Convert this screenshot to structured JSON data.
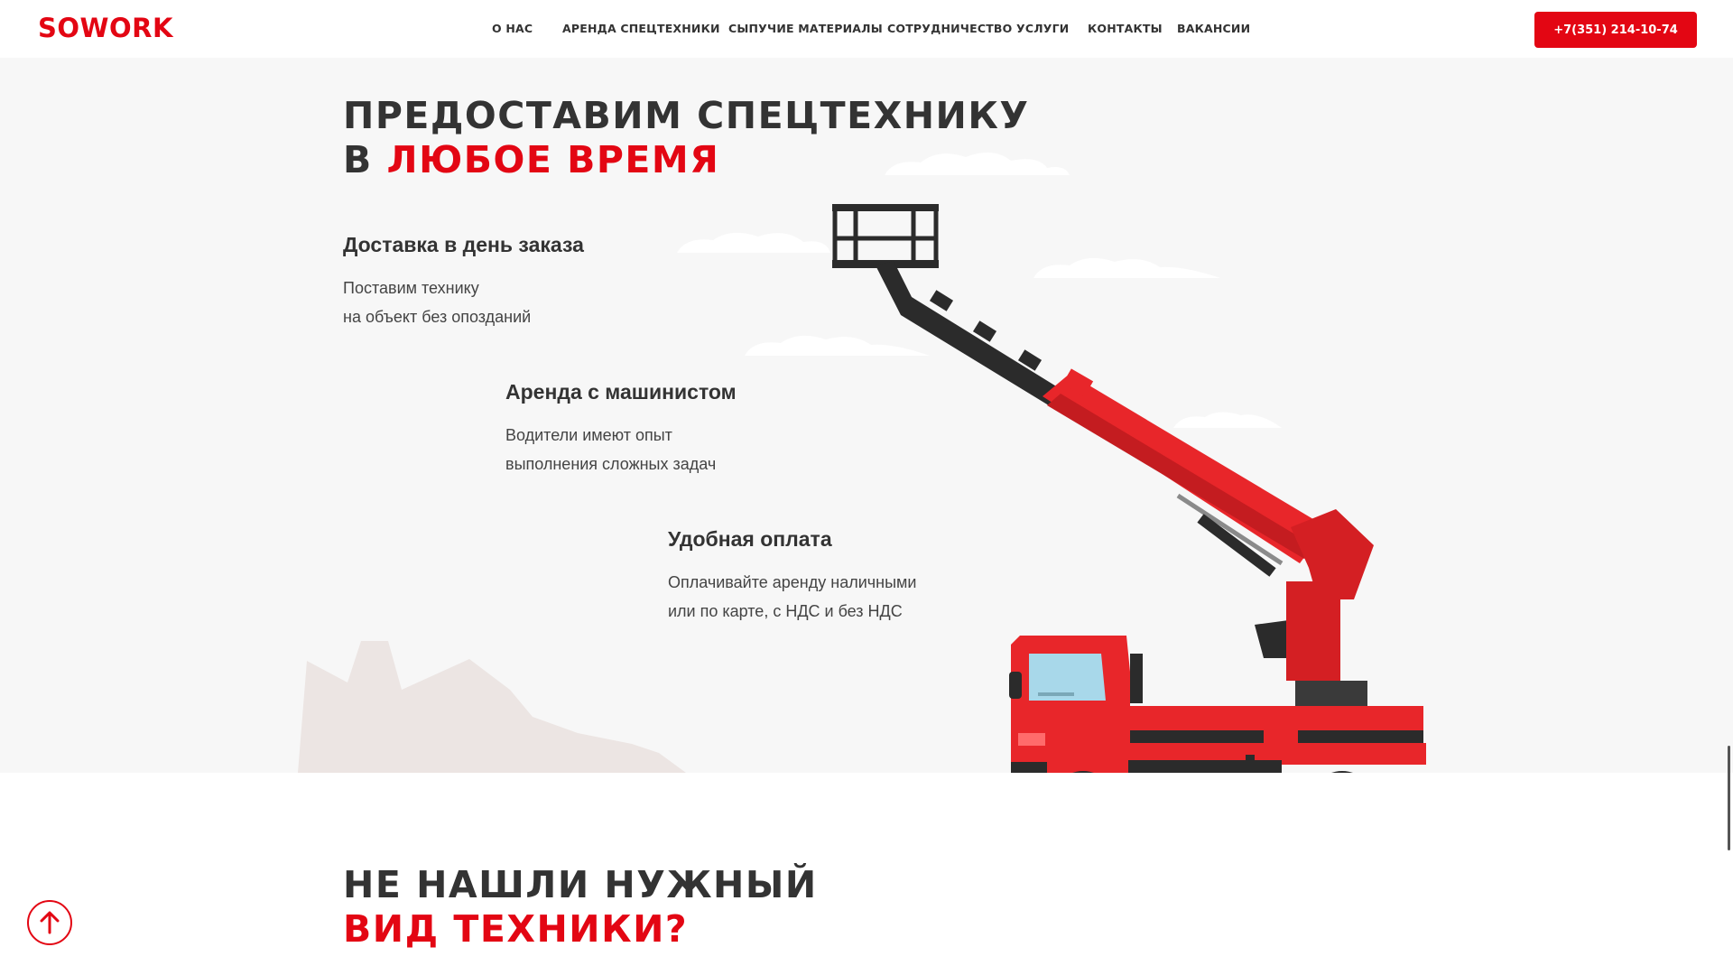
{
  "brand": {
    "logo": "SOWORK"
  },
  "nav": {
    "items": [
      {
        "label": "О НАС"
      },
      {
        "label": "АРЕНДА СПЕЦТЕХНИКИ"
      },
      {
        "label": "СЫПУЧИЕ МАТЕРИАЛЫ"
      },
      {
        "label": "СОТРУДНИЧЕСТВО"
      },
      {
        "label": "УСЛУГИ"
      },
      {
        "label": "КОНТАКТЫ"
      },
      {
        "label": "ВАКАНСИИ"
      }
    ],
    "phone": "+7(351) 214-10-74"
  },
  "hero": {
    "title_line1": "ПРЕДОСТАВИМ СПЕЦТЕХНИКУ",
    "title_prefix": "В ",
    "title_accent": "ЛЮБОЕ ВРЕМЯ",
    "features": [
      {
        "title": "Доставка в день заказа",
        "line1": "Поставим технику",
        "line2": "на объект без опозданий"
      },
      {
        "title": "Аренда с машинистом",
        "line1": "Водители имеют опыт",
        "line2": "выполнения сложных задач"
      },
      {
        "title": "Удобная оплата",
        "line1": "Оплачивайте аренду наличными",
        "line2": "или по карте, с НДС и без НДС"
      }
    ]
  },
  "section2": {
    "title_line1": "НЕ НАШЛИ НУЖНЫЙ",
    "title_accent": "ВИД ТЕХНИКИ?"
  },
  "icons": {
    "scroll_top": "arrow-up-circle-icon",
    "truck": "aerial-platform-truck-illustration"
  },
  "colors": {
    "accent": "#e30613",
    "text": "#333333",
    "hero_bg": "#f7f7f7",
    "mountain": "#ece5e3"
  }
}
